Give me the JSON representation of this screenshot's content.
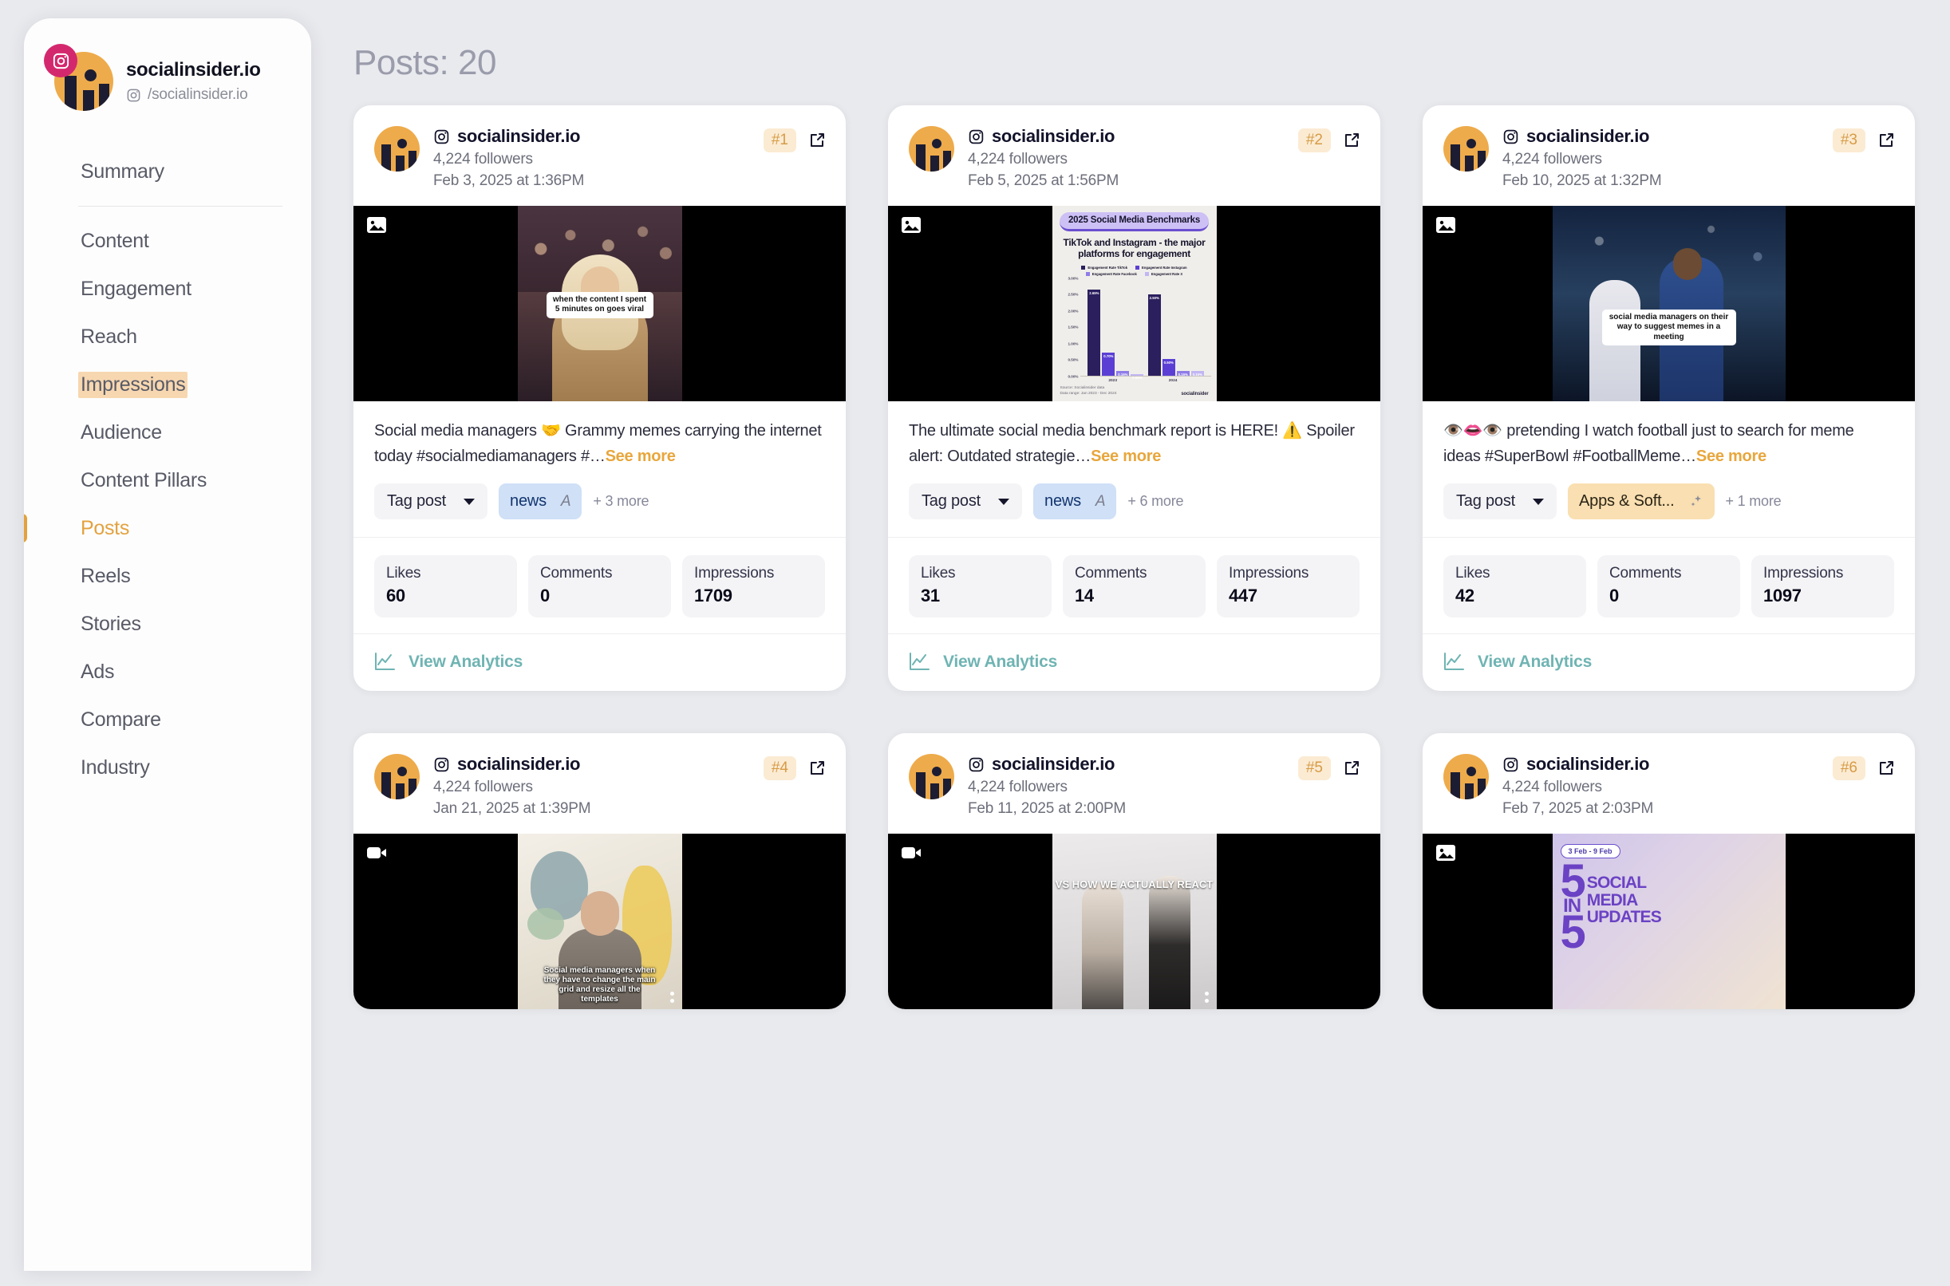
{
  "sidebar": {
    "profile": {
      "name": "socialinsider.io",
      "handle": "/socialinsider.io",
      "platform_icon": "instagram-icon"
    },
    "items": [
      {
        "label": "Summary",
        "state": "normal"
      },
      {
        "label": "Content",
        "state": "normal"
      },
      {
        "label": "Engagement",
        "state": "normal"
      },
      {
        "label": "Reach",
        "state": "normal"
      },
      {
        "label": "Impressions",
        "state": "highlighted"
      },
      {
        "label": "Audience",
        "state": "normal"
      },
      {
        "label": "Content Pillars",
        "state": "normal"
      },
      {
        "label": "Posts",
        "state": "active"
      },
      {
        "label": "Reels",
        "state": "normal"
      },
      {
        "label": "Stories",
        "state": "normal"
      },
      {
        "label": "Ads",
        "state": "normal"
      },
      {
        "label": "Compare",
        "state": "normal"
      },
      {
        "label": "Industry",
        "state": "normal"
      }
    ]
  },
  "main": {
    "page_title": "Posts: 20",
    "labels": {
      "tag_post": "Tag post",
      "see_more": "See more",
      "view_analytics": "View Analytics",
      "likes": "Likes",
      "comments": "Comments",
      "impressions": "Impressions"
    },
    "posts": [
      {
        "account": "socialinsider.io",
        "followers": "4,224 followers",
        "date": "Feb 3, 2025 at 1:36PM",
        "rank": "#1",
        "media_type": "image-icon",
        "caption": "Social media managers 🤝 Grammy memes carrying the internet today #socialmediamanagers #…",
        "tag": {
          "label": "news",
          "style": "blue",
          "icon": "a-icon"
        },
        "more_tags": "+ 3 more",
        "likes": "60",
        "comments": "0",
        "impressions": "1709"
      },
      {
        "account": "socialinsider.io",
        "followers": "4,224 followers",
        "date": "Feb 5, 2025 at 1:56PM",
        "rank": "#2",
        "media_type": "image-icon",
        "caption": "The ultimate social media benchmark report is HERE! ⚠️ Spoiler alert: Outdated strategie…",
        "tag": {
          "label": "news",
          "style": "blue",
          "icon": "a-icon"
        },
        "more_tags": "+ 6 more",
        "likes": "31",
        "comments": "14",
        "impressions": "447"
      },
      {
        "account": "socialinsider.io",
        "followers": "4,224 followers",
        "date": "Feb 10, 2025 at 1:32PM",
        "rank": "#3",
        "media_type": "image-icon",
        "caption": "👁️👄👁️ pretending I watch football just to search for meme ideas #SuperBowl #FootballMeme…",
        "tag": {
          "label": "Apps & Soft...",
          "style": "peach",
          "icon": "sparkle-icon"
        },
        "more_tags": "+ 1 more",
        "likes": "42",
        "comments": "0",
        "impressions": "1097"
      },
      {
        "account": "socialinsider.io",
        "followers": "4,224 followers",
        "date": "Jan 21, 2025 at 1:39PM",
        "rank": "#4",
        "media_type": "video-icon"
      },
      {
        "account": "socialinsider.io",
        "followers": "4,224 followers",
        "date": "Feb 11, 2025 at 2:00PM",
        "rank": "#5",
        "media_type": "video-icon"
      },
      {
        "account": "socialinsider.io",
        "followers": "4,224 followers",
        "date": "Feb 7, 2025 at 2:03PM",
        "rank": "#6",
        "media_type": "image-icon"
      }
    ],
    "media_overlays": {
      "post1_text": "when the content I spent 5 minutes on goes viral",
      "post3_text": "social media managers on their way to suggest memes in a meeting",
      "post4_text": "Social media managers when they have to change the main grid and resize all the templates",
      "post5_text": "VS HOW WE ACTUALLY REACT"
    },
    "five_in_five": {
      "date_range": "3 Feb - 9 Feb",
      "number": "5",
      "in": "IN",
      "number2": "5",
      "line1": "SOCIAL",
      "line2": "MEDIA",
      "line3": "UPDATES"
    }
  },
  "chart_data": {
    "type": "bar",
    "title": "2025 Social Media Benchmarks",
    "subtitle": "TikTok and Instagram - the major platforms for engagement",
    "categories": [
      "2023",
      "2024"
    ],
    "series": [
      {
        "name": "Engagement Rate TikTok",
        "values": [
          2.65,
          2.5
        ],
        "labels": [
          "2.65%",
          "2.50%"
        ],
        "color": "#2b1f5e"
      },
      {
        "name": "Engagement Rate Instagram",
        "values": [
          0.7,
          0.5
        ],
        "labels": [
          "0.70%",
          "0.50%"
        ],
        "color": "#5b3fd4"
      },
      {
        "name": "Engagement Rate Facebook",
        "values": [
          0.15,
          0.15
        ],
        "labels": [
          "0.15%",
          "0.15%"
        ],
        "color": "#8f7ce8"
      },
      {
        "name": "Engagement Rate X",
        "values": [
          0.05,
          0.15
        ],
        "labels": [
          "0.05%",
          "0.15%"
        ],
        "color": "#c2b6f3"
      }
    ],
    "yticks": [
      "0.00%",
      "0.50%",
      "1.00%",
      "1.50%",
      "2.00%",
      "2.50%",
      "3.00%"
    ],
    "ylim": [
      0,
      3.0
    ],
    "ylabel": "",
    "xlabel": "",
    "grid": false,
    "legend_position": "top",
    "source": "Source: Socialinsider data",
    "data_range": "Data range: Jan 2023 - Dec 2024",
    "brand": "socialinsider"
  }
}
